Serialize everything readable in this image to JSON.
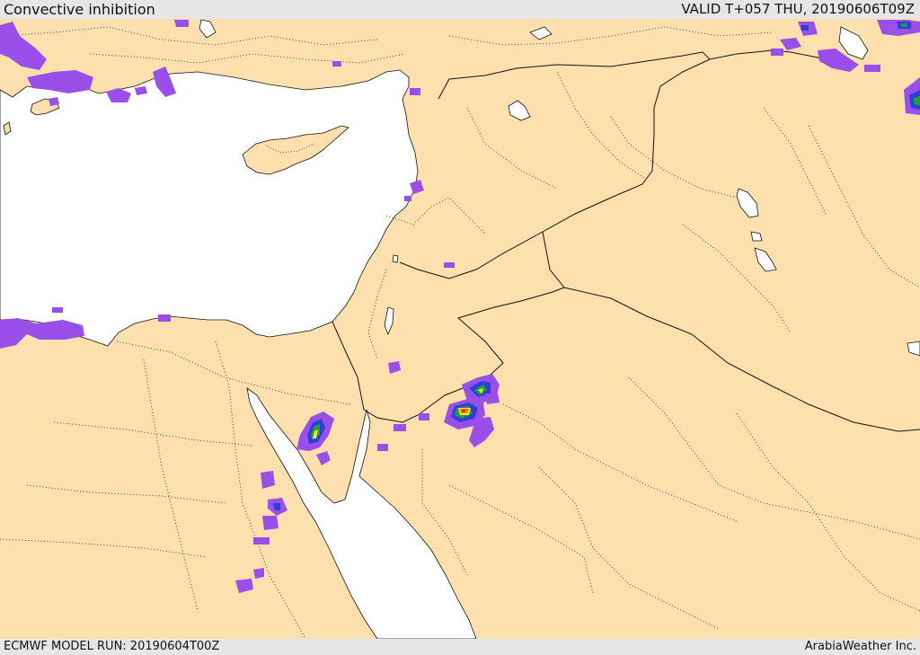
{
  "header": {
    "title": "Convective inhibition",
    "valid": "VALID T+057 THU, 20190606T09Z"
  },
  "footer": {
    "model_run": "ECMWF MODEL RUN: 20190604T00Z",
    "credit": "ArabiaWeather Inc."
  },
  "colors": {
    "land": "#fde0ad",
    "water": "#ffffff",
    "border": "#111111",
    "cin_light": "#9a50e8",
    "cin_blue": "#2c3fd6",
    "cin_green": "#1f9e3a",
    "cin_yellow": "#f3e81b",
    "cin_orange": "#f07a18",
    "cin_red": "#d41c1c"
  }
}
